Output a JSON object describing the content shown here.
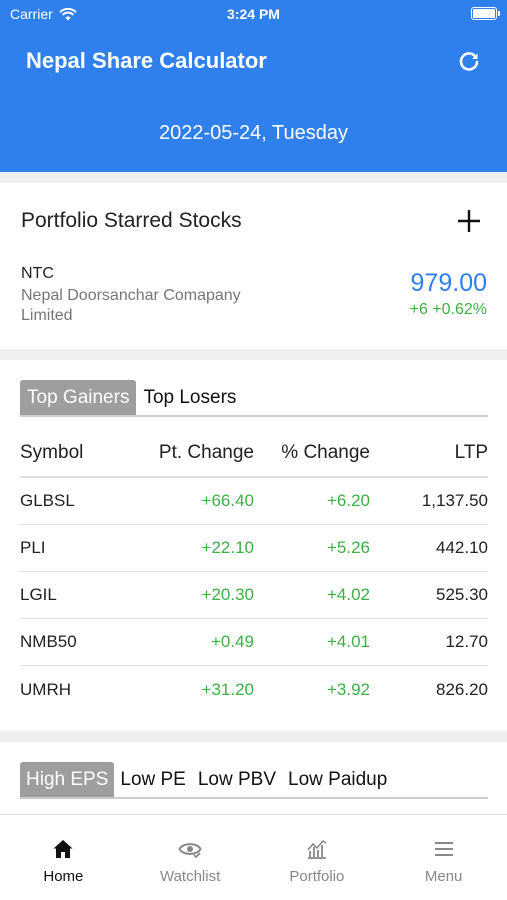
{
  "status_bar": {
    "carrier": "Carrier",
    "time": "3:24 PM"
  },
  "header": {
    "title": "Nepal Share Calculator",
    "date": "2022-05-24, Tuesday"
  },
  "starred": {
    "title": "Portfolio Starred Stocks",
    "stock": {
      "symbol": "NTC",
      "name": "Nepal Doorsanchar Comapany Limited",
      "price": "979.00",
      "change": "+6  +0.62%"
    }
  },
  "movers": {
    "tabs": [
      "Top Gainers",
      "Top Losers"
    ],
    "active_tab": "Top Gainers",
    "columns": [
      "Symbol",
      "Pt. Change",
      "% Change",
      "LTP"
    ],
    "rows": [
      {
        "symbol": "GLBSL",
        "pt_change": "+66.40",
        "pct_change": "+6.20",
        "ltp": "1,137.50"
      },
      {
        "symbol": "PLI",
        "pt_change": "+22.10",
        "pct_change": "+5.26",
        "ltp": "442.10"
      },
      {
        "symbol": "LGIL",
        "pt_change": "+20.30",
        "pct_change": "+4.02",
        "ltp": "525.30"
      },
      {
        "symbol": "NMB50",
        "pt_change": "+0.49",
        "pct_change": "+4.01",
        "ltp": "12.70"
      },
      {
        "symbol": "UMRH",
        "pt_change": "+31.20",
        "pct_change": "+3.92",
        "ltp": "826.20"
      }
    ]
  },
  "fundamentals": {
    "tabs": [
      "High EPS",
      "Low PE",
      "Low PBV",
      "Low Paidup"
    ],
    "active_tab": "High EPS"
  },
  "bottom_nav": {
    "items": [
      {
        "label": "Home",
        "icon": "home-icon",
        "active": true
      },
      {
        "label": "Watchlist",
        "icon": "eye-icon",
        "active": false
      },
      {
        "label": "Portfolio",
        "icon": "chart-icon",
        "active": false
      },
      {
        "label": "Menu",
        "icon": "menu-icon",
        "active": false
      }
    ]
  },
  "colors": {
    "primary": "#2f80ed",
    "positive": "#3cb043",
    "tab_active_bg": "#9e9e9e"
  }
}
